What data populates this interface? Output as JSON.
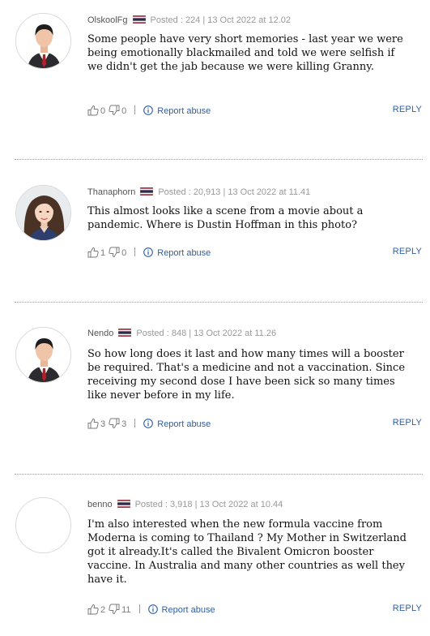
{
  "comments": [
    {
      "username": "OlskoolFg",
      "posted": "Posted : 224 | 13 Oct 2022 at 12.02",
      "body": "Some people have very short memories - last year we were being emotionally blackmailed and told we were selfish if we didn't get the jab because we were killing Granny.",
      "likes": "0",
      "dislikes": "0",
      "report_label": "Report abuse",
      "reply_label": "REPLY",
      "avatar": "default-man-avatar"
    },
    {
      "username": "Thanaphorn",
      "posted": "Posted : 20,913 | 13 Oct 2022 at 11.41",
      "body": "This almost looks like a scene from a movie about a pandemic. Where is Dustin Hoffman in this photo?",
      "likes": "1",
      "dislikes": "0",
      "report_label": "Report abuse",
      "reply_label": "REPLY",
      "avatar": "woman-photo-avatar"
    },
    {
      "username": "Nendo",
      "posted": "Posted : 848 | 13 Oct 2022 at 11.26",
      "body": "So how long does it last and how many times will a booster be required. That's a medicine and not a vaccination. Since receiving my second dose I have been sick so many times like never before in my life.",
      "likes": "3",
      "dislikes": "3",
      "report_label": "Report abuse",
      "reply_label": "REPLY",
      "avatar": "default-man-avatar"
    },
    {
      "username": "benno",
      "posted": "Posted : 3,918 | 13 Oct 2022 at 10.44",
      "body": "I'm also interested when the new formula vaccine from Moderna is coming to Thailand ? My Mother in Switzerland got it already.It's called the Bivalent Omicron booster vaccine. In Australia and many other countries as well they have it.",
      "likes": "2",
      "dislikes": "11",
      "report_label": "Report abuse",
      "reply_label": "REPLY",
      "avatar": "empty-avatar"
    }
  ],
  "colors": {
    "link": "#2d5fa6",
    "meta": "#999999",
    "divider": "#8a99b3"
  }
}
